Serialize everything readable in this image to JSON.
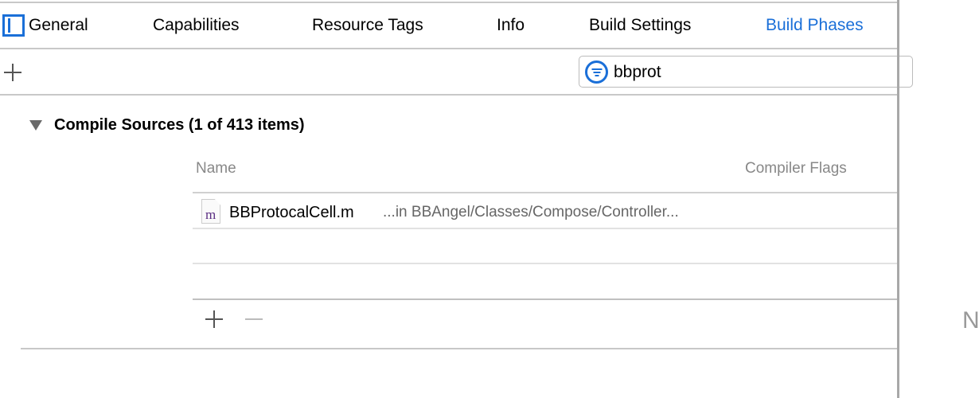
{
  "tabs": [
    {
      "label": "General",
      "active": false
    },
    {
      "label": "Capabilities",
      "active": false
    },
    {
      "label": "Resource Tags",
      "active": false
    },
    {
      "label": "Info",
      "active": false
    },
    {
      "label": "Build Settings",
      "active": false
    },
    {
      "label": "Build Phases",
      "active": true
    }
  ],
  "filter": {
    "value": "bbprot",
    "icon": "filter-icon"
  },
  "section": {
    "title": "Compile Sources (1 of 413 items)"
  },
  "table": {
    "columns": [
      "Name",
      "Compiler Flags"
    ],
    "rows": [
      {
        "name": "BBProtocalCell.m",
        "path": "...in BBAngel/Classes/Compose/Controller...",
        "icon_letter": "m"
      }
    ]
  },
  "right_panel": {
    "text": "N"
  },
  "colors": {
    "accent": "#1a6fd8"
  }
}
